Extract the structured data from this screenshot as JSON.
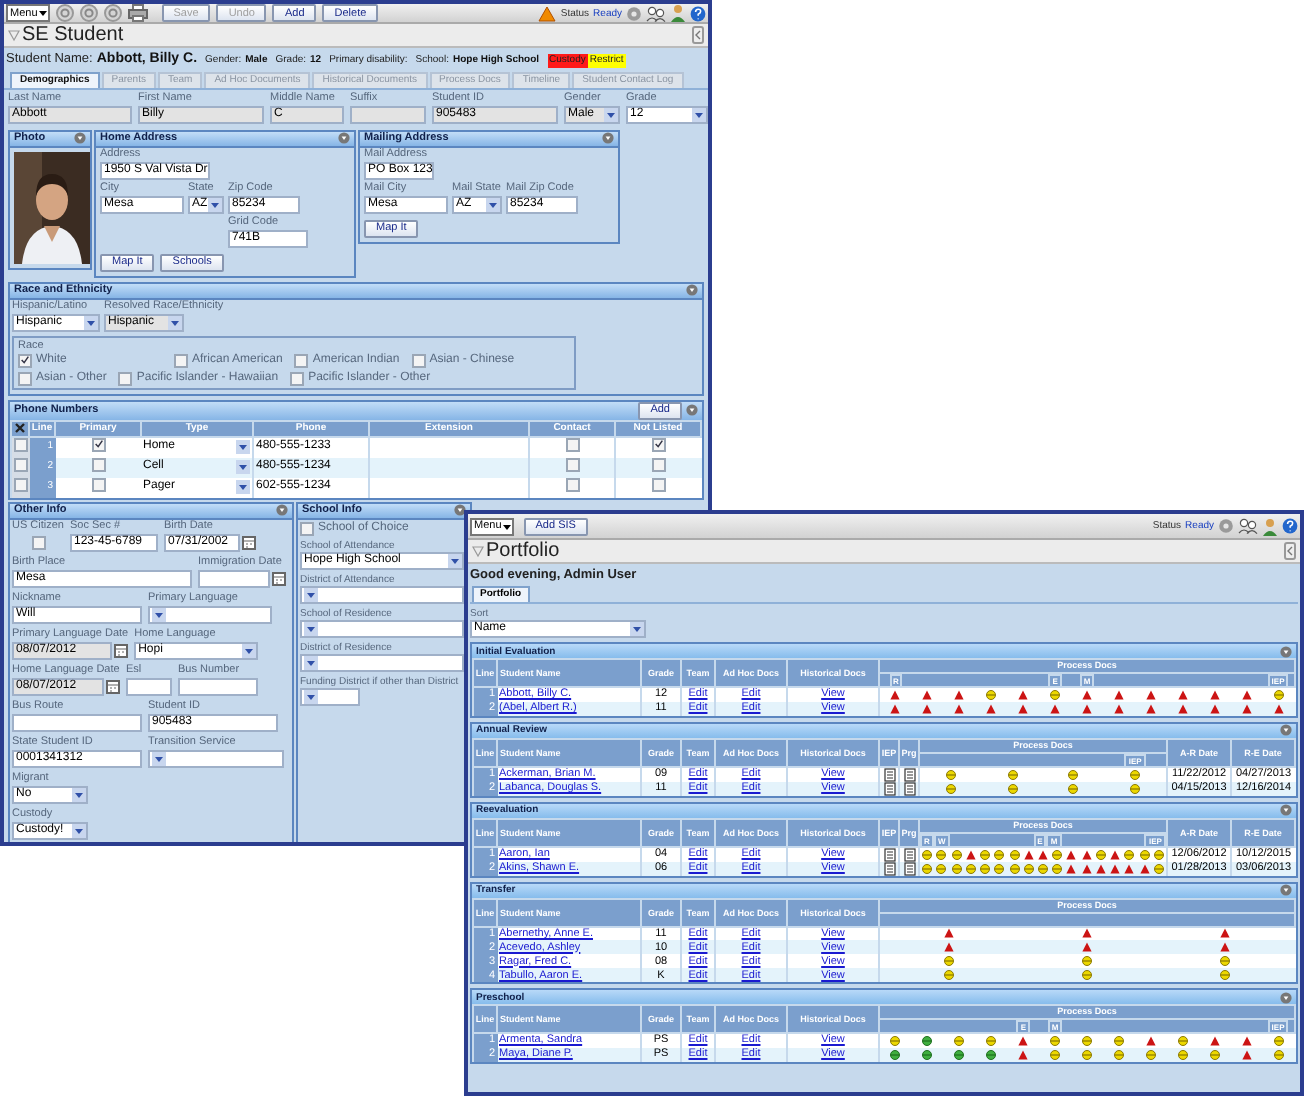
{
  "student_window": {
    "toolbar": {
      "menu": "Menu",
      "buttons": [
        {
          "label": "Save",
          "disabled": true
        },
        {
          "label": "Undo",
          "disabled": true
        },
        {
          "label": "Add",
          "disabled": false
        },
        {
          "label": "Delete",
          "disabled": false
        }
      ],
      "status_label": "Status",
      "status": "Ready"
    },
    "title": "SE Student",
    "summary": [
      {
        "label": "Student Name:",
        "value": "Abbott, Billy C."
      },
      {
        "label": "Gender:",
        "value": "Male"
      },
      {
        "label": "Grade:",
        "value": "12"
      },
      {
        "label": "Primary disability:"
      },
      {
        "label": "School:",
        "value": "Hope High School"
      }
    ],
    "flags": [
      {
        "label": "Custody",
        "color": "#ff1a1a"
      },
      {
        "label": "Restrict",
        "color": "#ffff00"
      }
    ],
    "tabs": [
      {
        "label": "Demographics",
        "selected": true
      },
      {
        "label": "Parents",
        "selected": false
      },
      {
        "label": "Team",
        "selected": false
      },
      {
        "label": "Ad Hoc Documents",
        "selected": false
      },
      {
        "label": "Historical Documents",
        "selected": false
      },
      {
        "label": "Process Docs",
        "selected": false
      },
      {
        "label": "Timeline",
        "selected": false
      },
      {
        "label": "Student Contact Log",
        "selected": false
      }
    ],
    "fields": [
      {
        "label": "Last Name",
        "value": "Abbott",
        "kind": "text",
        "disabled": true
      },
      {
        "label": "First Name",
        "value": "Billy",
        "kind": "text",
        "disabled": true
      },
      {
        "label": "Middle Name",
        "value": "C",
        "kind": "text",
        "disabled": true
      },
      {
        "label": "Suffix",
        "kind": "text",
        "disabled": true
      },
      {
        "label": "Student ID",
        "value": "905483",
        "kind": "text",
        "disabled": true
      },
      {
        "label": "Gender",
        "value": "Male",
        "kind": "select",
        "disabled": true
      },
      {
        "label": "Grade",
        "value": "12",
        "kind": "select",
        "disabled": false
      }
    ],
    "photo": {
      "title": "Photo"
    },
    "home_address": {
      "title": "Home Address",
      "fields": [
        {
          "label": "Address",
          "value": "1950 S Val Vista Dr",
          "kind": "text"
        },
        {
          "label": "City",
          "value": "Mesa",
          "kind": "text"
        },
        {
          "label": "State",
          "value": "AZ",
          "kind": "select"
        },
        {
          "label": "Zip Code",
          "value": "85234",
          "kind": "text"
        },
        {
          "label": "Grid Code",
          "value": "741B",
          "kind": "text"
        }
      ],
      "buttons": [
        "Map It",
        "Schools"
      ]
    },
    "mailing_address": {
      "title": "Mailing Address",
      "fields": [
        {
          "label": "Mail Address",
          "value": "PO Box 123",
          "kind": "text"
        },
        {
          "label": "Mail City",
          "value": "Mesa",
          "kind": "text"
        },
        {
          "label": "Mail State",
          "value": "AZ",
          "kind": "select"
        },
        {
          "label": "Mail Zip Code",
          "value": "85234",
          "kind": "text"
        }
      ],
      "buttons": [
        "Map It"
      ]
    },
    "race_ethnicity": {
      "title": "Race and Ethnicity",
      "fields": [
        {
          "label": "Hispanic/Latino",
          "value": "Hispanic",
          "kind": "select",
          "disabled": false
        },
        {
          "label": "Resolved Race/Ethnicity",
          "value": "Hispanic",
          "kind": "select",
          "disabled": true
        }
      ],
      "race_label": "Race",
      "races": [
        {
          "label": "White",
          "checked": true
        },
        {
          "label": "African American",
          "checked": false
        },
        {
          "label": "American Indian",
          "checked": false
        },
        {
          "label": "Asian - Chinese",
          "checked": false
        },
        {
          "label": "Asian - Other",
          "checked": false
        },
        {
          "label": "Pacific Islander - Hawaiian",
          "checked": false
        },
        {
          "label": "Pacific Islander - Other",
          "checked": false
        }
      ]
    },
    "phone_numbers": {
      "title": "Phone Numbers",
      "add": "Add",
      "columns": [
        "Line",
        "Primary",
        "Type",
        "Phone",
        "Extension",
        "Contact",
        "Not Listed"
      ],
      "rows": [
        {
          "selected": false,
          "line": "1",
          "primary": true,
          "type": "Home",
          "phone": "480-555-1233",
          "contact": false,
          "not_listed": true
        },
        {
          "selected": false,
          "line": "2",
          "primary": false,
          "type": "Cell",
          "phone": "480-555-1234",
          "contact": false,
          "not_listed": false
        },
        {
          "selected": false,
          "line": "3",
          "primary": false,
          "type": "Pager",
          "phone": "602-555-1234",
          "contact": false,
          "not_listed": false
        }
      ]
    },
    "other_info": {
      "title": "Other Info",
      "rows": [
        [
          {
            "label": "US Citizen",
            "kind": "checkbox",
            "checked": false
          },
          {
            "label": "Soc Sec #",
            "value": "123-45-6789",
            "kind": "text",
            "disabled": false
          },
          {
            "label": "Birth Date",
            "value": "07/31/2002",
            "kind": "date",
            "disabled": false
          }
        ],
        [
          {
            "label": "Birth Place",
            "value": "Mesa",
            "kind": "text",
            "disabled": false
          },
          {
            "label": "Immigration Date",
            "kind": "date",
            "disabled": false
          }
        ],
        [
          {
            "label": "Nickname",
            "value": "Will",
            "kind": "text",
            "disabled": false
          },
          {
            "label": "Primary Language",
            "kind": "select",
            "disabled": false
          }
        ],
        [
          {
            "label": "Primary Language Date",
            "value": "08/07/2012",
            "kind": "date",
            "disabled": true
          },
          {
            "label": "Home Language",
            "value": "Hopi",
            "kind": "select",
            "disabled": false
          }
        ],
        [
          {
            "label": "Home Language Date",
            "value": "08/07/2012",
            "kind": "date",
            "disabled": true
          },
          {
            "label": "Esl",
            "kind": "text",
            "disabled": false
          },
          {
            "label": "Bus Number",
            "kind": "text",
            "disabled": false
          }
        ],
        [
          {
            "label": "Bus Route",
            "kind": "text",
            "disabled": false
          },
          {
            "label": "Student ID",
            "value": "905483",
            "kind": "text",
            "disabled": false
          }
        ],
        [
          {
            "label": "State Student ID",
            "value": "0001341312",
            "kind": "text",
            "disabled": false
          },
          {
            "label": "Transition Service",
            "kind": "select",
            "disabled": false
          }
        ],
        [
          {
            "label": "Migrant",
            "value": "No",
            "kind": "select",
            "disabled": false
          }
        ],
        [
          {
            "label": "Custody",
            "value": "Custody!",
            "kind": "select",
            "disabled": false
          }
        ]
      ]
    },
    "school_info": {
      "title": "School Info",
      "fields": [
        {
          "label": "School of Choice",
          "kind": "checkbox",
          "checked": false
        },
        {
          "label": "School of Attendance",
          "value": "Hope High School",
          "kind": "select",
          "disabled": false
        },
        {
          "label": "District of Attendance",
          "kind": "select",
          "disabled": false
        },
        {
          "label": "School of Residence",
          "kind": "select",
          "disabled": false
        },
        {
          "label": "District of Residence",
          "kind": "select",
          "disabled": false
        },
        {
          "label": "Funding District if other than District",
          "kind": "select",
          "disabled": false
        }
      ]
    }
  },
  "portfolio_window": {
    "toolbar": {
      "menu": "Menu",
      "buttons": [
        "Add SIS"
      ],
      "status_label": "Status",
      "status": "Ready"
    },
    "title": "Portfolio",
    "greeting": "Good evening, Admin User",
    "tabs": [
      {
        "label": "Portfolio",
        "selected": true
      }
    ],
    "sort": {
      "label": "Sort",
      "value": "Name"
    },
    "sections": [
      {
        "title": "Initial Evaluation",
        "columns": [
          {
            "label": "Line",
            "kind": "line"
          },
          {
            "label": "Student Name",
            "kind": "name"
          },
          {
            "label": "Grade",
            "kind": "grade"
          },
          {
            "label": "Team",
            "kind": "team"
          },
          {
            "label": "Ad Hoc Docs",
            "kind": "ad_hoc"
          },
          {
            "label": "Historical Docs",
            "kind": "historical"
          },
          {
            "label": "Process Docs",
            "kind": "process"
          }
        ],
        "process_subheaders": [
          {
            "label": "R"
          },
          {
            "label": "E"
          },
          {
            "label": "M"
          },
          {
            "label": "IEP"
          }
        ],
        "rows": [
          {
            "line": "1",
            "name": "Abbott, Billy C.",
            "grade": "12",
            "team": "Edit",
            "ad_hoc": "Edit",
            "historical": "View",
            "docs": [
              {
                "kind": "late"
              },
              {
                "kind": "late"
              },
              {
                "kind": "late"
              },
              {
                "kind": "pending"
              },
              {
                "kind": "late"
              },
              {
                "kind": "pending"
              },
              {
                "kind": "late"
              },
              {
                "kind": "late"
              },
              {
                "kind": "late"
              },
              {
                "kind": "late"
              },
              {
                "kind": "late"
              },
              {
                "kind": "late"
              },
              {
                "kind": "pending"
              }
            ]
          },
          {
            "line": "2",
            "name": "(Abel, Albert R.)",
            "grade": "11",
            "team": "Edit",
            "ad_hoc": "Edit",
            "historical": "View",
            "docs": [
              {
                "kind": "late"
              },
              {
                "kind": "late"
              },
              {
                "kind": "late"
              },
              {
                "kind": "late"
              },
              {
                "kind": "late"
              },
              {
                "kind": "late"
              },
              {
                "kind": "late"
              },
              {
                "kind": "late"
              },
              {
                "kind": "late"
              },
              {
                "kind": "late"
              },
              {
                "kind": "late"
              },
              {
                "kind": "late"
              },
              {
                "kind": "late"
              }
            ]
          }
        ]
      },
      {
        "title": "Annual Review",
        "columns": [
          {
            "label": "Line",
            "kind": "line"
          },
          {
            "label": "Student Name",
            "kind": "name"
          },
          {
            "label": "Grade",
            "kind": "grade"
          },
          {
            "label": "Team",
            "kind": "team"
          },
          {
            "label": "Ad Hoc Docs",
            "kind": "ad_hoc"
          },
          {
            "label": "Historical Docs",
            "kind": "historical"
          },
          {
            "label": "IEP",
            "kind": "iep"
          },
          {
            "label": "Prg",
            "kind": "prg"
          },
          {
            "label": "Process Docs",
            "kind": "process"
          },
          {
            "label": "A-R Date",
            "kind": "ar_date"
          },
          {
            "label": "R-E Date",
            "kind": "re_date"
          }
        ],
        "process_subheaders": [
          {
            "label": "IEP"
          }
        ],
        "rows": [
          {
            "line": "1",
            "name": "Ackerman, Brian M.",
            "grade": "09",
            "team": "Edit",
            "ad_hoc": "Edit",
            "historical": "View",
            "docs": [
              {
                "kind": "pending"
              },
              {
                "kind": "pending"
              },
              {
                "kind": "pending"
              },
              {
                "kind": "pending"
              }
            ],
            "ar_date": "11/22/2012",
            "re_date": "04/27/2013"
          },
          {
            "line": "2",
            "name": "Labanca, Douglas S.",
            "grade": "11",
            "team": "Edit",
            "ad_hoc": "Edit",
            "historical": "View",
            "docs": [
              {
                "kind": "pending"
              },
              {
                "kind": "pending"
              },
              {
                "kind": "pending"
              },
              {
                "kind": "pending"
              }
            ],
            "ar_date": "04/15/2013",
            "re_date": "12/16/2014"
          }
        ]
      },
      {
        "title": "Reevaluation",
        "columns": [
          {
            "label": "Line",
            "kind": "line"
          },
          {
            "label": "Student Name",
            "kind": "name"
          },
          {
            "label": "Grade",
            "kind": "grade"
          },
          {
            "label": "Team",
            "kind": "team"
          },
          {
            "label": "Ad Hoc Docs",
            "kind": "ad_hoc"
          },
          {
            "label": "Historical Docs",
            "kind": "historical"
          },
          {
            "label": "IEP",
            "kind": "iep"
          },
          {
            "label": "Prg",
            "kind": "prg"
          },
          {
            "label": "Process Docs",
            "kind": "process"
          },
          {
            "label": "A-R Date",
            "kind": "ar_date"
          },
          {
            "label": "R-E Date",
            "kind": "re_date"
          }
        ],
        "process_subheaders": [
          {
            "label": "R"
          },
          {
            "label": "W"
          },
          {
            "label": "E"
          },
          {
            "label": "M"
          },
          {
            "label": "IEP"
          }
        ],
        "rows": [
          {
            "line": "1",
            "name": "Aaron, Ian",
            "grade": "04",
            "team": "Edit",
            "ad_hoc": "Edit",
            "historical": "View",
            "docs": [
              {
                "kind": "pending"
              },
              {
                "kind": "pending"
              },
              {
                "kind": "pending"
              },
              {
                "kind": "late"
              },
              {
                "kind": "pending"
              },
              {
                "kind": "pending"
              },
              {
                "kind": "pending"
              },
              {
                "kind": "late"
              },
              {
                "kind": "late"
              },
              {
                "kind": "pending"
              },
              {
                "kind": "late"
              },
              {
                "kind": "late"
              },
              {
                "kind": "pending"
              },
              {
                "kind": "late"
              },
              {
                "kind": "pending"
              },
              {
                "kind": "pending"
              },
              {
                "kind": "pending"
              }
            ],
            "ar_date": "12/06/2012",
            "re_date": "10/12/2015"
          },
          {
            "line": "2",
            "name": "Akins, Shawn E.",
            "grade": "06",
            "team": "Edit",
            "ad_hoc": "Edit",
            "historical": "View",
            "docs": [
              {
                "kind": "pending"
              },
              {
                "kind": "pending"
              },
              {
                "kind": "pending"
              },
              {
                "kind": "pending"
              },
              {
                "kind": "pending"
              },
              {
                "kind": "pending"
              },
              {
                "kind": "pending"
              },
              {
                "kind": "pending"
              },
              {
                "kind": "pending"
              },
              {
                "kind": "pending"
              },
              {
                "kind": "late"
              },
              {
                "kind": "late"
              },
              {
                "kind": "late"
              },
              {
                "kind": "late"
              },
              {
                "kind": "late"
              },
              {
                "kind": "late"
              },
              {
                "kind": "pending"
              }
            ],
            "ar_date": "01/28/2013",
            "re_date": "03/06/2013"
          }
        ]
      },
      {
        "title": "Transfer",
        "columns": [
          {
            "label": "Line",
            "kind": "line"
          },
          {
            "label": "Student Name",
            "kind": "name"
          },
          {
            "label": "Grade",
            "kind": "grade"
          },
          {
            "label": "Team",
            "kind": "team"
          },
          {
            "label": "Ad Hoc Docs",
            "kind": "ad_hoc"
          },
          {
            "label": "Historical Docs",
            "kind": "historical"
          },
          {
            "label": "Process Docs",
            "kind": "process"
          }
        ],
        "rows": [
          {
            "line": "1",
            "name": "Abernethy, Anne E.",
            "grade": "11",
            "team": "Edit",
            "ad_hoc": "Edit",
            "historical": "View",
            "docs": [
              {
                "kind": "late"
              },
              {
                "kind": "late"
              },
              {
                "kind": "late"
              }
            ]
          },
          {
            "line": "2",
            "name": "Acevedo, Ashley",
            "grade": "10",
            "team": "Edit",
            "ad_hoc": "Edit",
            "historical": "View",
            "docs": [
              {
                "kind": "late"
              },
              {
                "kind": "late"
              },
              {
                "kind": "late"
              }
            ]
          },
          {
            "line": "3",
            "name": "Ragar, Fred C.",
            "grade": "08",
            "team": "Edit",
            "ad_hoc": "Edit",
            "historical": "View",
            "docs": [
              {
                "kind": "pending"
              },
              {
                "kind": "pending"
              },
              {
                "kind": "pending"
              }
            ]
          },
          {
            "line": "4",
            "name": "Tabullo, Aaron E.",
            "grade": "K",
            "team": "Edit",
            "ad_hoc": "Edit",
            "historical": "View",
            "docs": [
              {
                "kind": "pending"
              },
              {
                "kind": "pending"
              },
              {
                "kind": "pending"
              }
            ]
          }
        ]
      },
      {
        "title": "Preschool",
        "columns": [
          {
            "label": "Line",
            "kind": "line"
          },
          {
            "label": "Student Name",
            "kind": "name"
          },
          {
            "label": "Grade",
            "kind": "grade"
          },
          {
            "label": "Team",
            "kind": "team"
          },
          {
            "label": "Ad Hoc Docs",
            "kind": "ad_hoc"
          },
          {
            "label": "Historical Docs",
            "kind": "historical"
          },
          {
            "label": "Process Docs",
            "kind": "process"
          }
        ],
        "process_subheaders": [
          {
            "label": "E"
          },
          {
            "label": "M"
          },
          {
            "label": "IEP"
          }
        ],
        "rows": [
          {
            "line": "1",
            "name": "Armenta, Sandra",
            "grade": "PS",
            "team": "Edit",
            "ad_hoc": "Edit",
            "historical": "View",
            "docs": [
              {
                "kind": "pending"
              },
              {
                "kind": "done"
              },
              {
                "kind": "pending"
              },
              {
                "kind": "pending"
              },
              {
                "kind": "late"
              },
              {
                "kind": "pending"
              },
              {
                "kind": "pending"
              },
              {
                "kind": "pending"
              },
              {
                "kind": "late"
              },
              {
                "kind": "pending"
              },
              {
                "kind": "late"
              },
              {
                "kind": "late"
              },
              {
                "kind": "pending"
              }
            ]
          },
          {
            "line": "2",
            "name": "Maya, Diane P.",
            "grade": "PS",
            "team": "Edit",
            "ad_hoc": "Edit",
            "historical": "View",
            "docs": [
              {
                "kind": "done"
              },
              {
                "kind": "done"
              },
              {
                "kind": "done"
              },
              {
                "kind": "done"
              },
              {
                "kind": "late"
              },
              {
                "kind": "pending"
              },
              {
                "kind": "pending"
              },
              {
                "kind": "pending"
              },
              {
                "kind": "pending"
              },
              {
                "kind": "pending"
              },
              {
                "kind": "pending"
              },
              {
                "kind": "late"
              },
              {
                "kind": "pending"
              }
            ]
          }
        ]
      }
    ]
  }
}
